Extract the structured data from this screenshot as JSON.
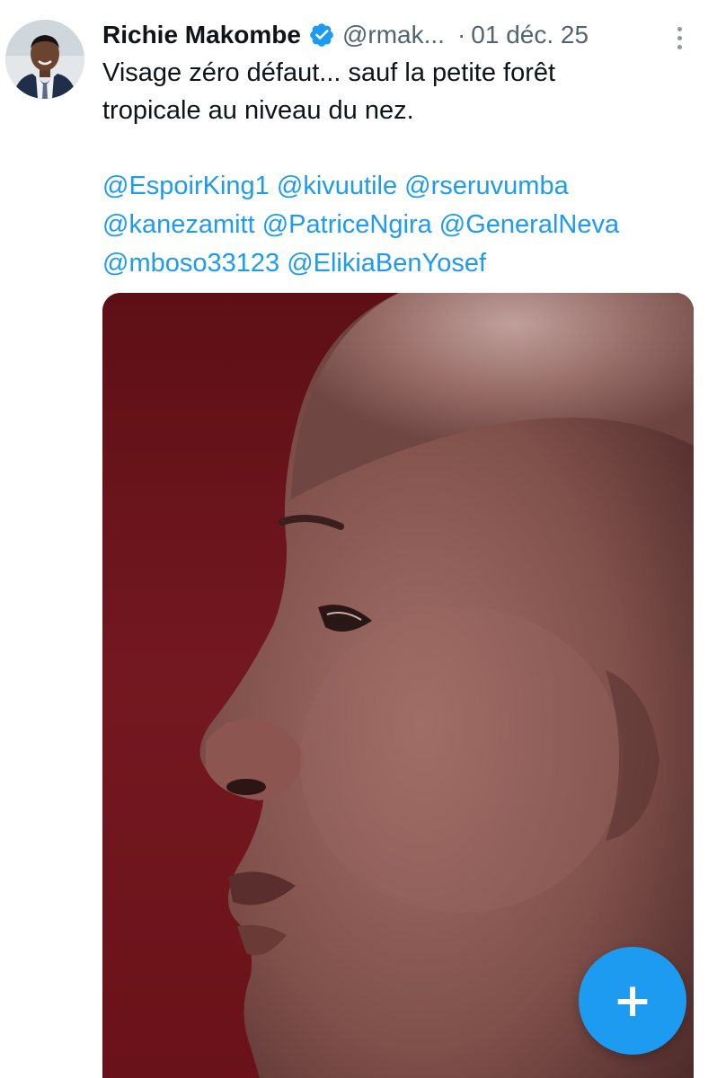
{
  "tweet": {
    "author": {
      "display_name": "Richie Makombe",
      "handle": "@rmak...",
      "verified": true,
      "avatar_icon": "profile-photo"
    },
    "separator": "·",
    "timestamp": "01 déc. 25",
    "more_icon": "more-vertical-icon",
    "text_lines": [
      "Visage zéro défaut... sauf la petite forêt",
      "tropicale au niveau du nez."
    ],
    "mentions": [
      [
        "@EspoirKing1",
        "@kivuutile",
        "@rseruvumba"
      ],
      [
        "@kanezamitt",
        "@PatriceNgira",
        "@GeneralNeva"
      ],
      [
        "@mboso33123",
        "@ElikiaBenYosef"
      ]
    ],
    "media": {
      "type": "photo"
    }
  },
  "compose_button": {
    "icon": "plus-icon",
    "glyph": "+"
  },
  "colors": {
    "accent": "#1d9bf0",
    "text": "#0f1419",
    "muted": "#536471",
    "photo_background": "#6e1218"
  }
}
